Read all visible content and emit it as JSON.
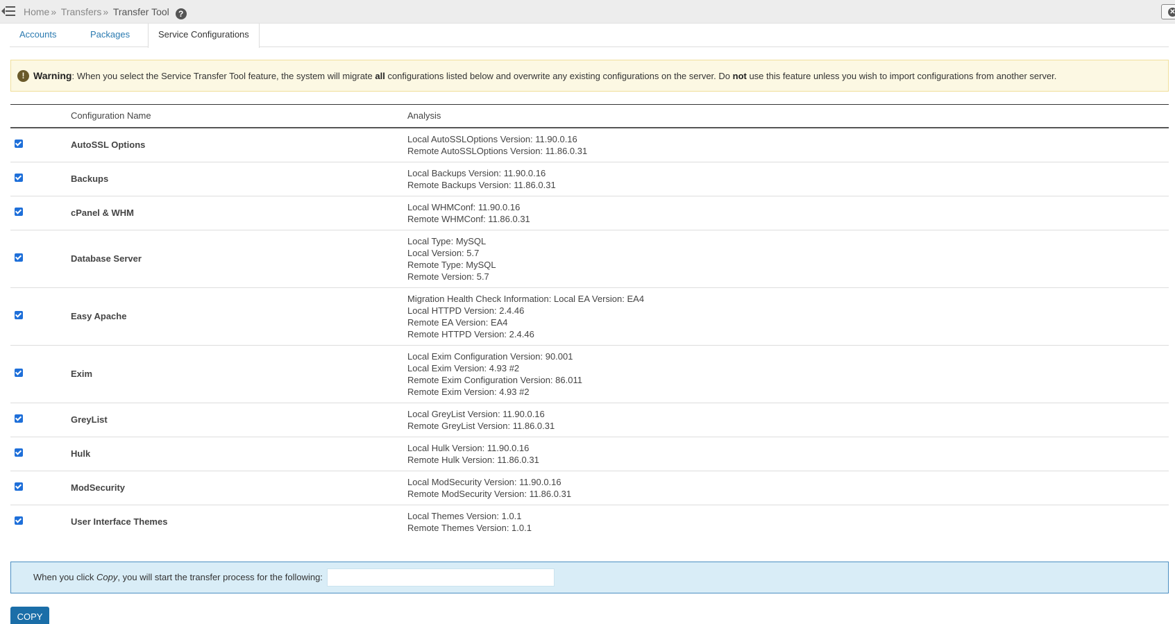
{
  "breadcrumb": {
    "home": "Home",
    "transfers": "Transfers",
    "current": "Transfer Tool",
    "separator": "»",
    "help_icon": "question-circle-icon"
  },
  "tabs": [
    {
      "label": "Accounts",
      "active": false
    },
    {
      "label": "Packages",
      "active": false
    },
    {
      "label": "Service Configurations",
      "active": true
    }
  ],
  "warning": {
    "icon": "exclamation-circle-icon",
    "label": "Warning",
    "text_1": ": When you select the Service Transfer Tool feature, the system will migrate ",
    "emph_1": "all",
    "text_2": " configurations listed below and overwrite any existing configurations on the server. Do ",
    "emph_2": "not",
    "text_3": " use this feature unless you wish to import configurations from another server."
  },
  "table": {
    "headers": {
      "name": "Configuration Name",
      "analysis": "Analysis"
    },
    "rows": [
      {
        "name": "AutoSSL Options",
        "checked": true,
        "analysis": [
          "Local AutoSSLOptions Version: 11.90.0.16",
          "Remote AutoSSLOptions Version: 11.86.0.31"
        ]
      },
      {
        "name": "Backups",
        "checked": true,
        "analysis": [
          "Local Backups Version: 11.90.0.16",
          "Remote Backups Version: 11.86.0.31"
        ]
      },
      {
        "name": "cPanel & WHM",
        "checked": true,
        "analysis": [
          "Local WHMConf: 11.90.0.16",
          "Remote WHMConf: 11.86.0.31"
        ]
      },
      {
        "name": "Database Server",
        "checked": true,
        "analysis": [
          "Local Type: MySQL",
          "Local Version: 5.7",
          "Remote Type: MySQL",
          "Remote Version: 5.7"
        ]
      },
      {
        "name": "Easy Apache",
        "checked": true,
        "analysis": [
          "Migration Health Check Information: Local EA Version: EA4",
          "Local HTTPD Version: 2.4.46",
          "Remote EA Version: EA4",
          "Remote HTTPD Version: 2.4.46"
        ]
      },
      {
        "name": "Exim",
        "checked": true,
        "analysis": [
          "Local Exim Configuration Version: 90.001",
          "Local Exim Version: 4.93 #2",
          "Remote Exim Configuration Version: 86.011",
          "Remote Exim Version: 4.93 #2"
        ]
      },
      {
        "name": "GreyList",
        "checked": true,
        "analysis": [
          "Local GreyList Version: 11.90.0.16",
          "Remote GreyList Version: 11.86.0.31"
        ]
      },
      {
        "name": "Hulk",
        "checked": true,
        "analysis": [
          "Local Hulk Version: 11.90.0.16",
          "Remote Hulk Version: 11.86.0.31"
        ]
      },
      {
        "name": "ModSecurity",
        "checked": true,
        "analysis": [
          "Local ModSecurity Version: 11.90.0.16",
          "Remote ModSecurity Version: 11.86.0.31"
        ]
      },
      {
        "name": "User Interface Themes",
        "checked": true,
        "analysis": [
          "Local Themes Version: 1.0.1",
          "Remote Themes Version: 1.0.1"
        ]
      }
    ]
  },
  "info": {
    "text_1": "When you click ",
    "emph": "Copy",
    "text_2": ", you will start the transfer process for the following:",
    "target_value": ""
  },
  "copy_button": "COPY",
  "colors": {
    "accent": "#1b6ea8",
    "link": "#2a7ab0",
    "warning_bg": "#fcf8e3",
    "info_bg": "#d9edf7",
    "checkbox": "#1e6fd9"
  }
}
